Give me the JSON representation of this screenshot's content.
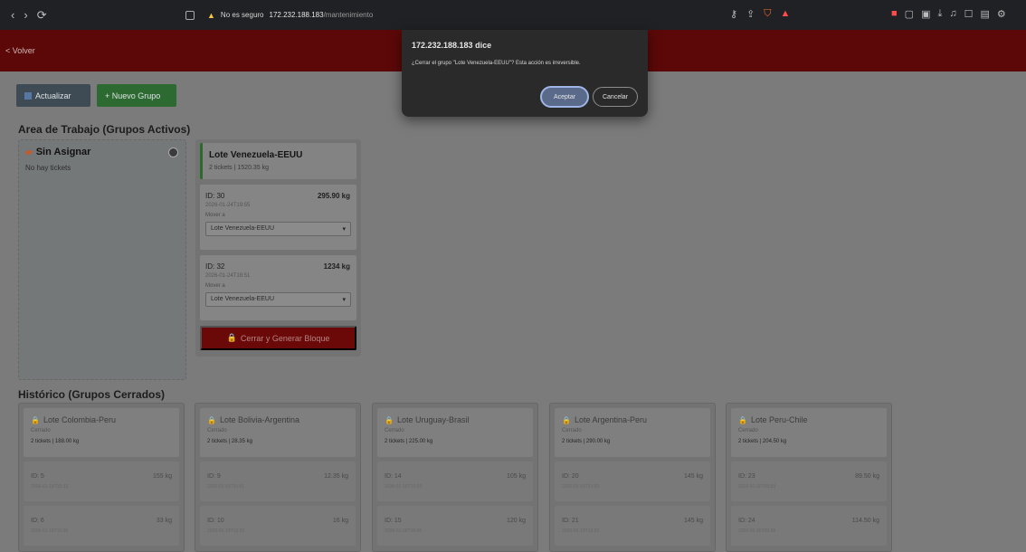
{
  "browser": {
    "nav": {
      "back": "‹",
      "forward": "›",
      "reload": "⟳"
    },
    "security_label": "No es seguro",
    "url_host": "172.232.188.183",
    "url_path": "/mantenimiento"
  },
  "header": {
    "back_label": "< Volver"
  },
  "toolbar": {
    "refresh_label": "Actualizar",
    "new_group_label": "+ Nuevo Grupo"
  },
  "workspace": {
    "title": "Area de Trabajo (Grupos Activos)",
    "unassigned": {
      "title": "Sin Asignar",
      "empty_text": "No hay tickets"
    },
    "active_group": {
      "name": "Lote Venezuela-EEUU",
      "summary": "2 tickets | 1520.35 kg",
      "move_label": "Mover a",
      "tickets": [
        {
          "id": "ID: 30",
          "weight": "295.90 kg",
          "date": "2026-01-24T19:55",
          "selected": "Lote Venezuela-EEUU"
        },
        {
          "id": "ID: 32",
          "weight": "1234 kg",
          "date": "2026-01-24T18:51",
          "selected": "Lote Venezuela-EEUU"
        }
      ],
      "close_label": "Cerrar y Generar Bloque"
    }
  },
  "history": {
    "title": "Histórico (Grupos Cerrados)",
    "groups": [
      {
        "name": "Lote Colombia-Peru",
        "status": "Cerrado",
        "summary": "2 tickets | 188.00 kg",
        "tickets": [
          {
            "id": "ID: 5",
            "weight": "155 kg",
            "date": "2026-01-19T10:33"
          },
          {
            "id": "ID: 6",
            "weight": "33 kg",
            "date": "2026-01-19T10:35"
          }
        ]
      },
      {
        "name": "Lote Bolivia-Argentina",
        "status": "Cerrado",
        "summary": "2 tickets | 28.35 kg",
        "tickets": [
          {
            "id": "ID: 9",
            "weight": "12.35 kg",
            "date": "2026-01-19T10:51"
          },
          {
            "id": "ID: 10",
            "weight": "16 kg",
            "date": "2026-01-19T10:52"
          }
        ]
      },
      {
        "name": "Lote Uruguay-Brasil",
        "status": "Cerrado",
        "summary": "2 tickets | 225.00 kg",
        "tickets": [
          {
            "id": "ID: 14",
            "weight": "105 kg",
            "date": "2026-01-19T10:53"
          },
          {
            "id": "ID: 15",
            "weight": "120 kg",
            "date": "2026-01-19T10:56"
          }
        ]
      },
      {
        "name": "Lote Argentina-Peru",
        "status": "Cerrado",
        "summary": "2 tickets | 290.00 kg",
        "tickets": [
          {
            "id": "ID: 20",
            "weight": "145 kg",
            "date": "2026-01-19T13:53"
          },
          {
            "id": "ID: 21",
            "weight": "145 kg",
            "date": "2026-01-19T13:53"
          }
        ]
      },
      {
        "name": "Lote Peru-Chile",
        "status": "Cerrado",
        "summary": "2 tickets | 204.50 kg",
        "tickets": [
          {
            "id": "ID: 23",
            "weight": "89.50 kg",
            "date": "2026-01-20T09:53"
          },
          {
            "id": "ID: 24",
            "weight": "114.50 kg",
            "date": "2026-01-20T09:55"
          }
        ]
      }
    ]
  },
  "dialog": {
    "title": "172.232.188.183 dice",
    "message": "¿Cerrar el grupo \"Lote Venezuela-EEUU\"? Esta acción es irreversible.",
    "ok_label": "Aceptar",
    "cancel_label": "Cancelar"
  },
  "colors": {
    "header_bg": "#5c0808",
    "accent_green": "#2d6a31",
    "danger": "#6b0808"
  }
}
